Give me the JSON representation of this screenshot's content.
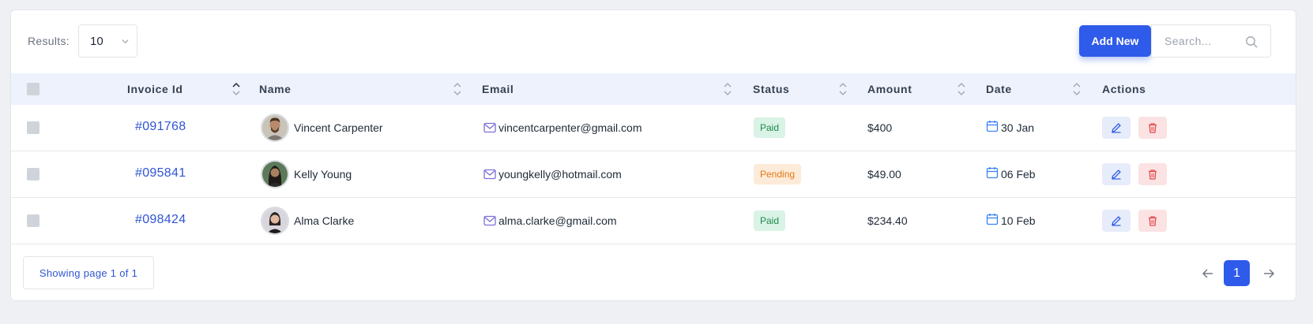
{
  "toolbar": {
    "results_label": "Results:",
    "page_size": "10",
    "add_new_label": "Add New",
    "search_placeholder": "Search..."
  },
  "table": {
    "columns": [
      "Invoice Id",
      "Name",
      "Email",
      "Status",
      "Amount",
      "Date",
      "Actions"
    ],
    "rows": [
      {
        "invoice": "#091768",
        "name": "Vincent Carpenter",
        "email": "vincentcarpenter@gmail.com",
        "status": "Paid",
        "amount": "$400",
        "date": "30 Jan"
      },
      {
        "invoice": "#095841",
        "name": "Kelly Young",
        "email": "youngkelly@hotmail.com",
        "status": "Pending",
        "amount": "$49.00",
        "date": "06 Feb"
      },
      {
        "invoice": "#098424",
        "name": "Alma Clarke",
        "email": "alma.clarke@gmail.com",
        "status": "Paid",
        "amount": "$234.40",
        "date": "10 Feb"
      }
    ]
  },
  "footer": {
    "showing_text": "Showing page 1 of 1",
    "current_page": "1"
  },
  "icons": {
    "search": "search-icon",
    "mail": "mail-icon",
    "calendar": "calendar-icon",
    "edit": "pencil-icon",
    "delete": "trash-icon",
    "prev": "arrow-left-icon",
    "next": "arrow-right-icon"
  },
  "colors": {
    "primary": "#2f5bea",
    "link": "#2f55d4",
    "paid_bg": "#d9f3e6",
    "paid_text": "#1f8a4c",
    "pending_bg": "#fdebd9",
    "pending_text": "#e07a12",
    "delete_tint": "#fbe3e3",
    "edit_tint": "#e7ecfb",
    "header_bg": "#edf2fd"
  }
}
